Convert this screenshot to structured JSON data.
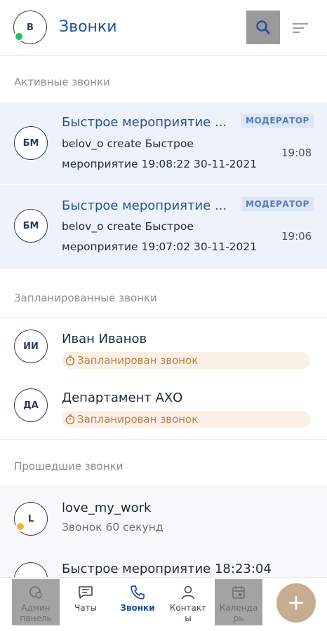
{
  "header": {
    "avatar_initial": "В",
    "title": "Звонки",
    "status_color": "#1fbf5a"
  },
  "sections": {
    "active": "Активные звонки",
    "scheduled": "Запланированные звонки",
    "past": "Прошедшие звонки"
  },
  "active_calls": [
    {
      "initials": "БМ",
      "title": "Быстрое мероприятие ...",
      "badge": "МОДЕРАТОР",
      "line1": "belov_o create Быстрое",
      "line2": "мероприятие 19:08:22 30-11-2021",
      "time": "19:08"
    },
    {
      "initials": "БМ",
      "title": "Быстрое мероприятие ...",
      "badge": "МОДЕРАТОР",
      "line1": "belov_o create Быстрое",
      "line2": "мероприятие 19:07:02 30-11-2021",
      "time": "19:06"
    }
  ],
  "scheduled_calls": [
    {
      "initials": "ИИ",
      "title": "Иван Иванов",
      "status": "Запланирован звонок"
    },
    {
      "initials": "ДА",
      "title": "Департамент АХО",
      "status": "Запланирован звонок"
    }
  ],
  "past_calls": [
    {
      "initials": "L",
      "title": "love_my_work",
      "subtitle": "Звонок 60 секунд",
      "status_color": "#f2b632"
    },
    {
      "initials": "",
      "title": "Быстрое мероприятие 18:23:04"
    }
  ],
  "nav": {
    "admin": "Админ панель",
    "admin_line1": "Админ",
    "admin_line2": "панель",
    "chats": "Чаты",
    "calls": "Звонки",
    "contacts_line1": "Контакт",
    "contacts_line2": "ы",
    "calendar_line1": "Календа",
    "calendar_line2": "рь"
  },
  "colors": {
    "accent": "#1f4fa0",
    "active_bg": "#eef3fb",
    "badge_bg": "#dde6f5",
    "scheduled_bg": "#fbf0e6",
    "fab": "#c6ad91"
  }
}
